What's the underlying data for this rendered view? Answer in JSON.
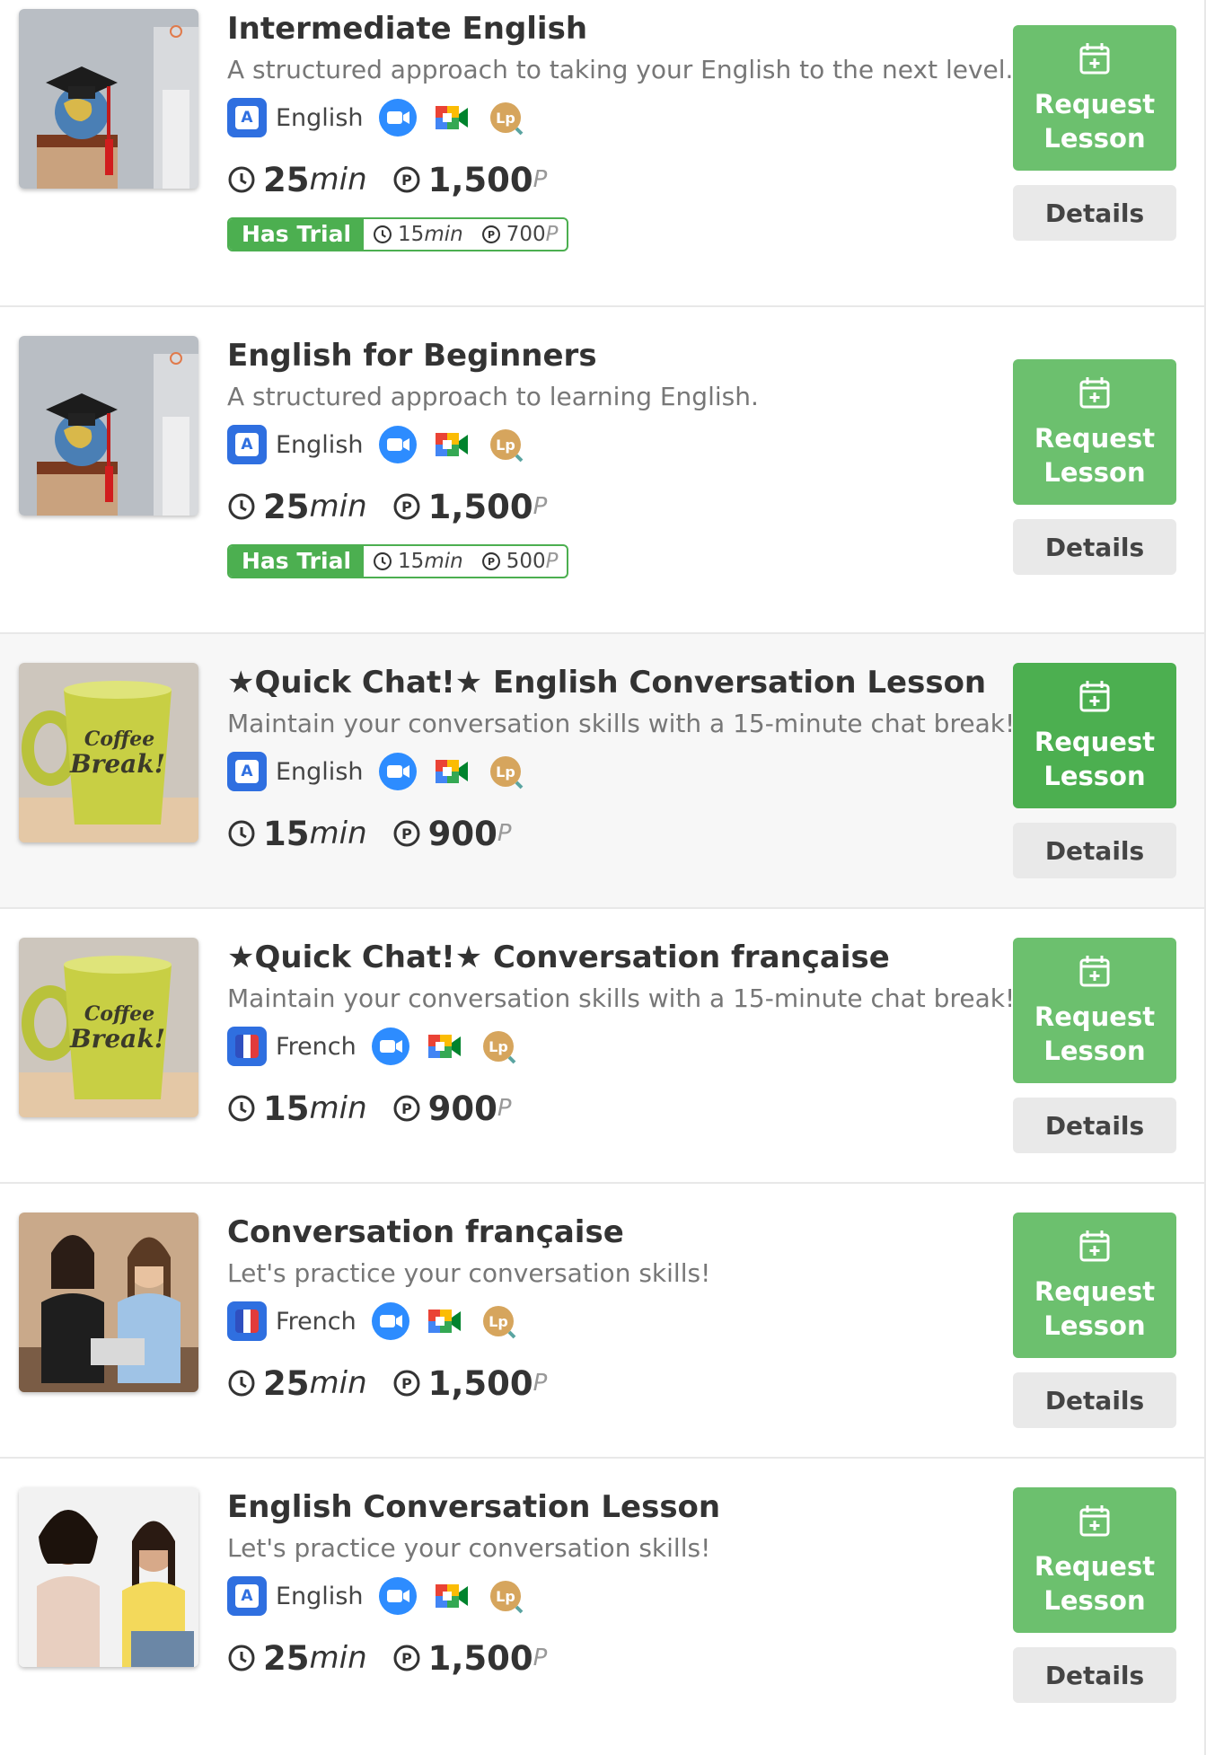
{
  "colors": {
    "accent_green": "#6cc06e",
    "accent_green_dark": "#4caf50",
    "badge_blue": "#2f6fe0"
  },
  "labels": {
    "request": "Request Lesson",
    "details": "Details",
    "has_trial": "Has Trial"
  },
  "lessons": [
    {
      "title": "Intermediate English",
      "subtitle": "A structured approach to taking your English to the next level.",
      "image": "graduation-cap-globe",
      "language": "English",
      "duration": "25",
      "duration_unit": "min",
      "price": "1,500",
      "price_unit": "P",
      "trial": {
        "duration": "15",
        "duration_unit": "min",
        "price": "700",
        "price_unit": "P"
      }
    },
    {
      "title": "English for Beginners",
      "subtitle": "A structured approach to learning English.",
      "image": "graduation-cap-globe",
      "language": "English",
      "duration": "25",
      "duration_unit": "min",
      "price": "1,500",
      "price_unit": "P",
      "trial": {
        "duration": "15",
        "duration_unit": "min",
        "price": "500",
        "price_unit": "P"
      }
    },
    {
      "title": "★Quick Chat!★ English Conversation Lesson",
      "subtitle": "Maintain your conversation skills with a 15-minute chat break!",
      "image": "coffee-break-mug",
      "mug_text_1": "Coffee",
      "mug_text_2": "Break!",
      "language": "English",
      "duration": "15",
      "duration_unit": "min",
      "price": "900",
      "price_unit": "P"
    },
    {
      "title": "★Quick Chat!★ Conversation française",
      "subtitle": "Maintain your conversation skills with a 15-minute chat break!",
      "image": "coffee-break-mug",
      "mug_text_1": "Coffee",
      "mug_text_2": "Break!",
      "language": "French",
      "duration": "15",
      "duration_unit": "min",
      "price": "900",
      "price_unit": "P"
    },
    {
      "title": "Conversation française",
      "subtitle": "Let's practice your conversation skills!",
      "image": "two-women-talking",
      "language": "French",
      "duration": "25",
      "duration_unit": "min",
      "price": "1,500",
      "price_unit": "P"
    },
    {
      "title": "English Conversation Lesson",
      "subtitle": "Let's practice your conversation skills!",
      "image": "two-women-conversation",
      "language": "English",
      "duration": "25",
      "duration_unit": "min",
      "price": "1,500",
      "price_unit": "P"
    }
  ]
}
